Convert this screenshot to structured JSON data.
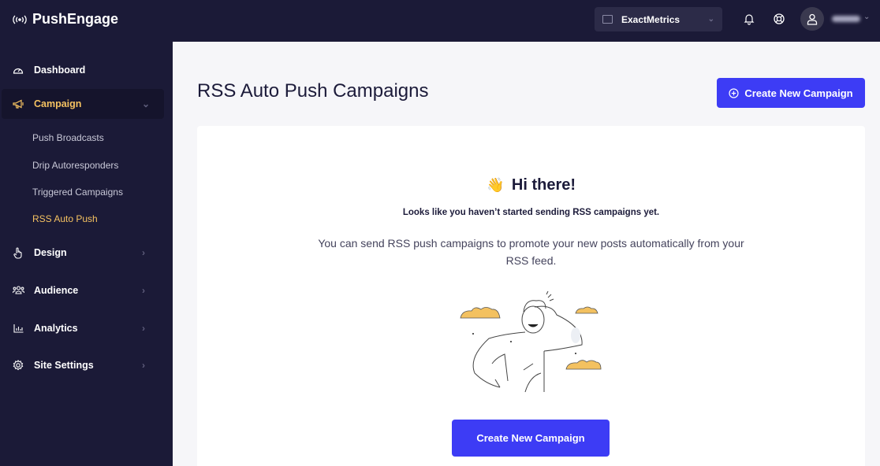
{
  "app": {
    "name": "PushEngage"
  },
  "topbar": {
    "site_selector": {
      "value": "ExactMetrics"
    },
    "icons": [
      "bell-icon",
      "help-lifebuoy-icon",
      "user-icon"
    ]
  },
  "sidebar": {
    "items": [
      {
        "label": "Dashboard",
        "icon": "dashboard-gauge-icon"
      },
      {
        "label": "Campaign",
        "icon": "megaphone-icon",
        "expanded": true,
        "children": [
          {
            "label": "Push Broadcasts"
          },
          {
            "label": "Drip Autoresponders"
          },
          {
            "label": "Triggered Campaigns"
          },
          {
            "label": "RSS Auto Push",
            "active": true
          }
        ]
      },
      {
        "label": "Design",
        "icon": "pointer-hand-icon"
      },
      {
        "label": "Audience",
        "icon": "audience-group-icon"
      },
      {
        "label": "Analytics",
        "icon": "bar-chart-icon"
      },
      {
        "label": "Site Settings",
        "icon": "gear-icon"
      }
    ]
  },
  "main": {
    "title": "RSS Auto Push Campaigns",
    "create_button": "Create New Campaign",
    "empty_state": {
      "emoji": "👋",
      "heading": "Hi there!",
      "subheading": "Looks like you haven’t started sending RSS campaigns yet.",
      "description": "You can send RSS push campaigns to promote your new posts automatically from your RSS feed.",
      "cta": "Create New Campaign"
    }
  },
  "colors": {
    "sidebar_bg": "#1b1a37",
    "accent": "#3d3cf5",
    "active_nav": "#f5c261",
    "content_bg": "#f6f6f9"
  }
}
